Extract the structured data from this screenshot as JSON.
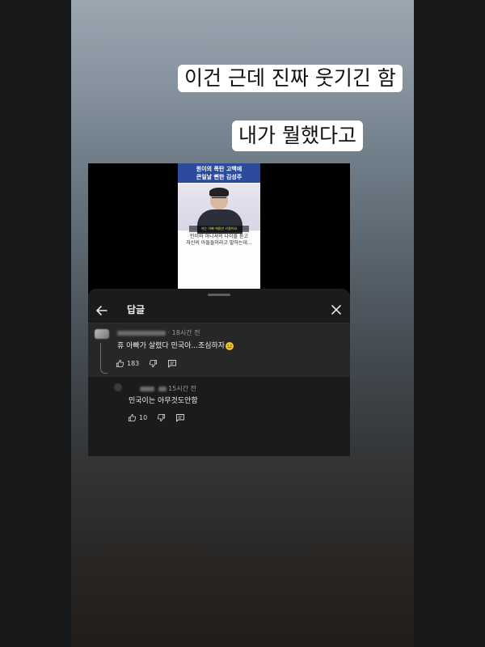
{
  "captions": {
    "line1": "이건 근데 진짜 웃기긴 함",
    "line2": "내가 뭘했다고"
  },
  "video_thumbnail": {
    "title_line1": "원이의 폭탄 고백에",
    "title_line2": "큰일날 뻔한 김성주",
    "subtitle": "저는 아빠 애들만 키웠어요",
    "caption_line1": "민이와 아니셔의 나이를 듣고",
    "caption_line2": "자신의 아들들이라고 말하는데..."
  },
  "reply_sheet": {
    "title": "답글",
    "back_icon": "arrow-left-icon",
    "close_icon": "close-icon",
    "comment": {
      "time": "· 18시간 전",
      "text": "휴 아빠가 살렸다 민국아...조심하자",
      "emoji": "grinning-sweat-emoji",
      "like_count": "183"
    },
    "reply": {
      "time": "15시간 전",
      "text": "민국이는 아무것도안함",
      "like_count": "10"
    }
  },
  "colors": {
    "sheet_bg": "#1b1b1c",
    "highlight_bg": "#272727",
    "thumbnail_banner": "#2c4b9c"
  }
}
